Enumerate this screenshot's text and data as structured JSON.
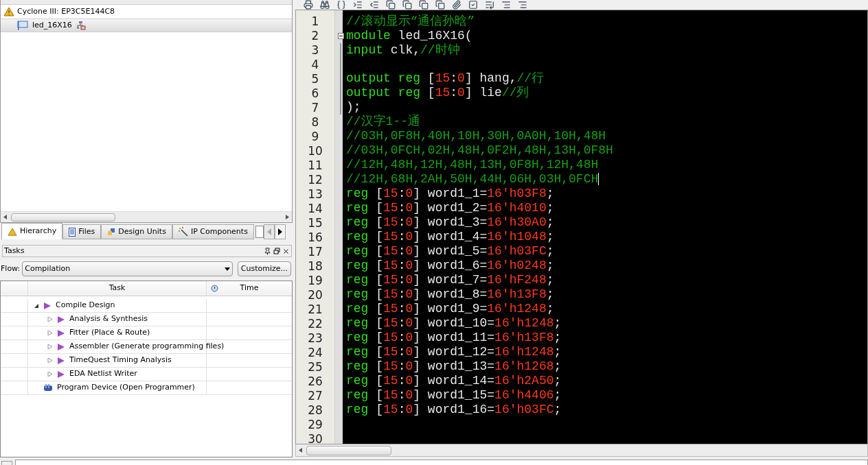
{
  "hierarchy": {
    "items": [
      {
        "label": "Cyclone III: EP3C5E144C8",
        "selected": false,
        "children": [
          {
            "label": "led_16X16",
            "selected": true
          }
        ]
      }
    ]
  },
  "panel_tabs": [
    {
      "label": "Hierarchy",
      "selected": true
    },
    {
      "label": "Files",
      "selected": false
    },
    {
      "label": "Design Units",
      "selected": false
    },
    {
      "label": "IP Components",
      "selected": false
    }
  ],
  "tasks": {
    "title": "Tasks",
    "flow_label": "Flow:",
    "flow_value": "Compilation",
    "customize_button": "Customize...",
    "columns": [
      "Task",
      "Time"
    ],
    "rows": [
      {
        "label": "Compile Design",
        "expanded": true,
        "children": [
          {
            "label": "Analysis & Synthesis",
            "expanded": false
          },
          {
            "label": "Fitter (Place & Route)",
            "expanded": false
          },
          {
            "label": "Assembler (Generate programming files)",
            "expanded": false
          },
          {
            "label": "TimeQuest Timing Analysis",
            "expanded": false
          },
          {
            "label": "EDA Netlist Writer",
            "expanded": false
          }
        ]
      },
      {
        "label": "Program Device (Open Programmer)"
      }
    ]
  },
  "editor": {
    "lines": [
      {
        "number": "1",
        "tokens": [
          {
            "kind": "comment",
            "text": "//滚动显示“通信孙晗”"
          }
        ]
      },
      {
        "number": "2",
        "fold_expanded": true,
        "tokens": [
          {
            "kind": "keyword",
            "text": "module"
          },
          {
            "kind": "plain",
            "text": " led_16X16("
          }
        ]
      },
      {
        "number": "3",
        "in_fold": true,
        "tokens": [
          {
            "kind": "keyword",
            "text": "input"
          },
          {
            "kind": "plain",
            "text": " clk,"
          },
          {
            "kind": "comment",
            "text": "//时钟"
          }
        ]
      },
      {
        "number": "4",
        "in_fold": true
      },
      {
        "number": "5",
        "in_fold": true,
        "tokens": [
          {
            "kind": "keyword",
            "text": "output reg"
          },
          {
            "kind": "plain",
            "text": " ["
          },
          {
            "kind": "number",
            "text": "15"
          },
          {
            "kind": "plain",
            "text": ":"
          },
          {
            "kind": "number",
            "text": "0"
          },
          {
            "kind": "plain",
            "text": "] hang,"
          },
          {
            "kind": "comment",
            "text": "//行"
          }
        ]
      },
      {
        "number": "6",
        "in_fold": true,
        "tokens": [
          {
            "kind": "keyword",
            "text": "output reg"
          },
          {
            "kind": "plain",
            "text": " ["
          },
          {
            "kind": "number",
            "text": "15"
          },
          {
            "kind": "plain",
            "text": ":"
          },
          {
            "kind": "number",
            "text": "0"
          },
          {
            "kind": "plain",
            "text": "] lie"
          },
          {
            "kind": "comment",
            "text": "//列"
          }
        ]
      },
      {
        "number": "7",
        "in_fold": true,
        "tokens": [
          {
            "kind": "plain",
            "text": ");"
          }
        ]
      },
      {
        "number": "8",
        "tokens": [
          {
            "kind": "comment",
            "text": "//汉字1--通"
          }
        ]
      },
      {
        "number": "9",
        "tokens": [
          {
            "kind": "comment",
            "text": "//03H,0F8H,40H,10H,30H,0A0H,10H,48H"
          }
        ]
      },
      {
        "number": "10",
        "tokens": [
          {
            "kind": "comment",
            "text": "//03H,0FCH,02H,48H,0F2H,48H,13H,0F8H"
          }
        ]
      },
      {
        "number": "11",
        "tokens": [
          {
            "kind": "comment",
            "text": "//12H,48H,12H,48H,13H,0F8H,12H,48H"
          }
        ]
      },
      {
        "number": "12",
        "cursor": true,
        "tokens": [
          {
            "kind": "comment",
            "text": "//12H,68H,2AH,50H,44H,06H,03H,0FCH"
          }
        ]
      },
      {
        "number": "13",
        "tokens": [
          {
            "kind": "keyword",
            "text": "reg"
          },
          {
            "kind": "plain",
            "text": " ["
          },
          {
            "kind": "number",
            "text": "15"
          },
          {
            "kind": "plain",
            "text": ":"
          },
          {
            "kind": "number",
            "text": "0"
          },
          {
            "kind": "plain",
            "text": "] word1_1="
          },
          {
            "kind": "number",
            "text": "16'h03F8"
          },
          {
            "kind": "plain",
            "text": ";"
          }
        ]
      },
      {
        "number": "14",
        "tokens": [
          {
            "kind": "keyword",
            "text": "reg"
          },
          {
            "kind": "plain",
            "text": " ["
          },
          {
            "kind": "number",
            "text": "15"
          },
          {
            "kind": "plain",
            "text": ":"
          },
          {
            "kind": "number",
            "text": "0"
          },
          {
            "kind": "plain",
            "text": "] word1_2="
          },
          {
            "kind": "number",
            "text": "16'h4010"
          },
          {
            "kind": "plain",
            "text": ";"
          }
        ]
      },
      {
        "number": "15",
        "tokens": [
          {
            "kind": "keyword",
            "text": "reg"
          },
          {
            "kind": "plain",
            "text": " ["
          },
          {
            "kind": "number",
            "text": "15"
          },
          {
            "kind": "plain",
            "text": ":"
          },
          {
            "kind": "number",
            "text": "0"
          },
          {
            "kind": "plain",
            "text": "] word1_3="
          },
          {
            "kind": "number",
            "text": "16'h30A0"
          },
          {
            "kind": "plain",
            "text": ";"
          }
        ]
      },
      {
        "number": "16",
        "tokens": [
          {
            "kind": "keyword",
            "text": "reg"
          },
          {
            "kind": "plain",
            "text": " ["
          },
          {
            "kind": "number",
            "text": "15"
          },
          {
            "kind": "plain",
            "text": ":"
          },
          {
            "kind": "number",
            "text": "0"
          },
          {
            "kind": "plain",
            "text": "] word1_4="
          },
          {
            "kind": "number",
            "text": "16'h1048"
          },
          {
            "kind": "plain",
            "text": ";"
          }
        ]
      },
      {
        "number": "17",
        "tokens": [
          {
            "kind": "keyword",
            "text": "reg"
          },
          {
            "kind": "plain",
            "text": " ["
          },
          {
            "kind": "number",
            "text": "15"
          },
          {
            "kind": "plain",
            "text": ":"
          },
          {
            "kind": "number",
            "text": "0"
          },
          {
            "kind": "plain",
            "text": "] word1_5="
          },
          {
            "kind": "number",
            "text": "16'h03FC"
          },
          {
            "kind": "plain",
            "text": ";"
          }
        ]
      },
      {
        "number": "18",
        "tokens": [
          {
            "kind": "keyword",
            "text": "reg"
          },
          {
            "kind": "plain",
            "text": " ["
          },
          {
            "kind": "number",
            "text": "15"
          },
          {
            "kind": "plain",
            "text": ":"
          },
          {
            "kind": "number",
            "text": "0"
          },
          {
            "kind": "plain",
            "text": "] word1_6="
          },
          {
            "kind": "number",
            "text": "16'h0248"
          },
          {
            "kind": "plain",
            "text": ";"
          }
        ]
      },
      {
        "number": "19",
        "tokens": [
          {
            "kind": "keyword",
            "text": "reg"
          },
          {
            "kind": "plain",
            "text": " ["
          },
          {
            "kind": "number",
            "text": "15"
          },
          {
            "kind": "plain",
            "text": ":"
          },
          {
            "kind": "number",
            "text": "0"
          },
          {
            "kind": "plain",
            "text": "] word1_7="
          },
          {
            "kind": "number",
            "text": "16'hF248"
          },
          {
            "kind": "plain",
            "text": ";"
          }
        ]
      },
      {
        "number": "20",
        "tokens": [
          {
            "kind": "keyword",
            "text": "reg"
          },
          {
            "kind": "plain",
            "text": " ["
          },
          {
            "kind": "number",
            "text": "15"
          },
          {
            "kind": "plain",
            "text": ":"
          },
          {
            "kind": "number",
            "text": "0"
          },
          {
            "kind": "plain",
            "text": "] word1_8="
          },
          {
            "kind": "number",
            "text": "16'h13F8"
          },
          {
            "kind": "plain",
            "text": ";"
          }
        ]
      },
      {
        "number": "21",
        "tokens": [
          {
            "kind": "keyword",
            "text": "reg"
          },
          {
            "kind": "plain",
            "text": " ["
          },
          {
            "kind": "number",
            "text": "15"
          },
          {
            "kind": "plain",
            "text": ":"
          },
          {
            "kind": "number",
            "text": "0"
          },
          {
            "kind": "plain",
            "text": "] word1_9="
          },
          {
            "kind": "number",
            "text": "16'h1248"
          },
          {
            "kind": "plain",
            "text": ";"
          }
        ]
      },
      {
        "number": "22",
        "tokens": [
          {
            "kind": "keyword",
            "text": "reg"
          },
          {
            "kind": "plain",
            "text": " ["
          },
          {
            "kind": "number",
            "text": "15"
          },
          {
            "kind": "plain",
            "text": ":"
          },
          {
            "kind": "number",
            "text": "0"
          },
          {
            "kind": "plain",
            "text": "] word1_10="
          },
          {
            "kind": "number",
            "text": "16'h1248"
          },
          {
            "kind": "plain",
            "text": ";"
          }
        ]
      },
      {
        "number": "23",
        "tokens": [
          {
            "kind": "keyword",
            "text": "reg"
          },
          {
            "kind": "plain",
            "text": " ["
          },
          {
            "kind": "number",
            "text": "15"
          },
          {
            "kind": "plain",
            "text": ":"
          },
          {
            "kind": "number",
            "text": "0"
          },
          {
            "kind": "plain",
            "text": "] word1_11="
          },
          {
            "kind": "number",
            "text": "16'h13F8"
          },
          {
            "kind": "plain",
            "text": ";"
          }
        ]
      },
      {
        "number": "24",
        "tokens": [
          {
            "kind": "keyword",
            "text": "reg"
          },
          {
            "kind": "plain",
            "text": " ["
          },
          {
            "kind": "number",
            "text": "15"
          },
          {
            "kind": "plain",
            "text": ":"
          },
          {
            "kind": "number",
            "text": "0"
          },
          {
            "kind": "plain",
            "text": "] word1_12="
          },
          {
            "kind": "number",
            "text": "16'h1248"
          },
          {
            "kind": "plain",
            "text": ";"
          }
        ]
      },
      {
        "number": "25",
        "tokens": [
          {
            "kind": "keyword",
            "text": "reg"
          },
          {
            "kind": "plain",
            "text": " ["
          },
          {
            "kind": "number",
            "text": "15"
          },
          {
            "kind": "plain",
            "text": ":"
          },
          {
            "kind": "number",
            "text": "0"
          },
          {
            "kind": "plain",
            "text": "] word1_13="
          },
          {
            "kind": "number",
            "text": "16'h1268"
          },
          {
            "kind": "plain",
            "text": ";"
          }
        ]
      },
      {
        "number": "26",
        "tokens": [
          {
            "kind": "keyword",
            "text": "reg"
          },
          {
            "kind": "plain",
            "text": " ["
          },
          {
            "kind": "number",
            "text": "15"
          },
          {
            "kind": "plain",
            "text": ":"
          },
          {
            "kind": "number",
            "text": "0"
          },
          {
            "kind": "plain",
            "text": "] word1_14="
          },
          {
            "kind": "number",
            "text": "16'h2A50"
          },
          {
            "kind": "plain",
            "text": ";"
          }
        ]
      },
      {
        "number": "27",
        "tokens": [
          {
            "kind": "keyword",
            "text": "reg"
          },
          {
            "kind": "plain",
            "text": " ["
          },
          {
            "kind": "number",
            "text": "15"
          },
          {
            "kind": "plain",
            "text": ":"
          },
          {
            "kind": "number",
            "text": "0"
          },
          {
            "kind": "plain",
            "text": "] word1_15="
          },
          {
            "kind": "number",
            "text": "16'h4406"
          },
          {
            "kind": "plain",
            "text": ";"
          }
        ]
      },
      {
        "number": "28",
        "tokens": [
          {
            "kind": "keyword",
            "text": "reg"
          },
          {
            "kind": "plain",
            "text": " ["
          },
          {
            "kind": "number",
            "text": "15"
          },
          {
            "kind": "plain",
            "text": ":"
          },
          {
            "kind": "number",
            "text": "0"
          },
          {
            "kind": "plain",
            "text": "] word1_16="
          },
          {
            "kind": "number",
            "text": "16'h03FC"
          },
          {
            "kind": "plain",
            "text": ";"
          }
        ]
      },
      {
        "number": "29"
      },
      {
        "number": "30"
      }
    ]
  }
}
